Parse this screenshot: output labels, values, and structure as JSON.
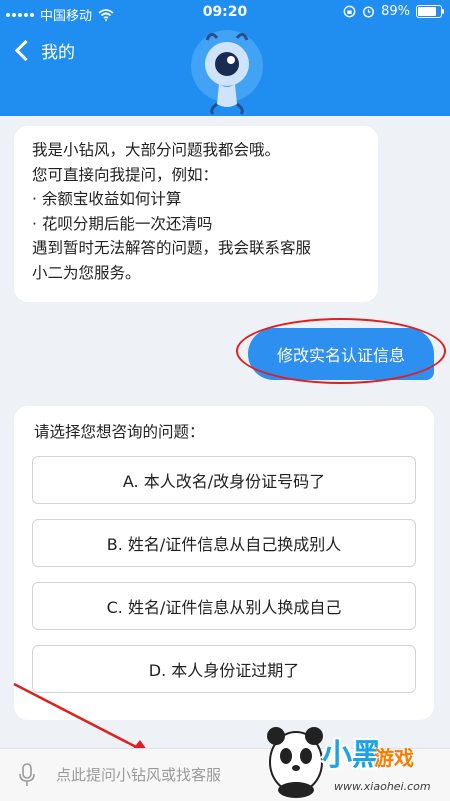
{
  "status_bar": {
    "carrier": "中国移动",
    "time": "09:20",
    "battery": "89%",
    "battery_level": 0.89
  },
  "header": {
    "back_label": "我的"
  },
  "bot_message": {
    "lines": [
      "我是小钻风，大部分问题我都会哦。",
      "您可直接向我提问，例如：",
      "· 余额宝收益如何计算",
      "· 花呗分期后能一次还清吗",
      "遇到暂时无法解答的问题，我会联系客服",
      "小二为您服务。"
    ]
  },
  "user_message": "修改实名认证信息",
  "question_card": {
    "title": "请选择您想咨询的问题：",
    "options": [
      "A. 本人改名/改身份证号码了",
      "B. 姓名/证件信息从自己换成别人",
      "C. 姓名/证件信息从别人换成自己",
      "D. 本人身份证过期了"
    ]
  },
  "input_bar": {
    "placeholder": "点此提问小钻风或找客服"
  },
  "watermark": {
    "brand": "小黑",
    "brand2": "游戏",
    "url": "www.xiaohei.com"
  },
  "colors": {
    "header_blue": "#1f8ef0",
    "user_bubble": "#2d8ff0",
    "annotation_red": "#e02020"
  },
  "icons": [
    "wifi-icon",
    "signal-icon",
    "alarm-icon",
    "battery-icon",
    "back-chevron-icon",
    "mascot-avatar",
    "mic-icon"
  ]
}
